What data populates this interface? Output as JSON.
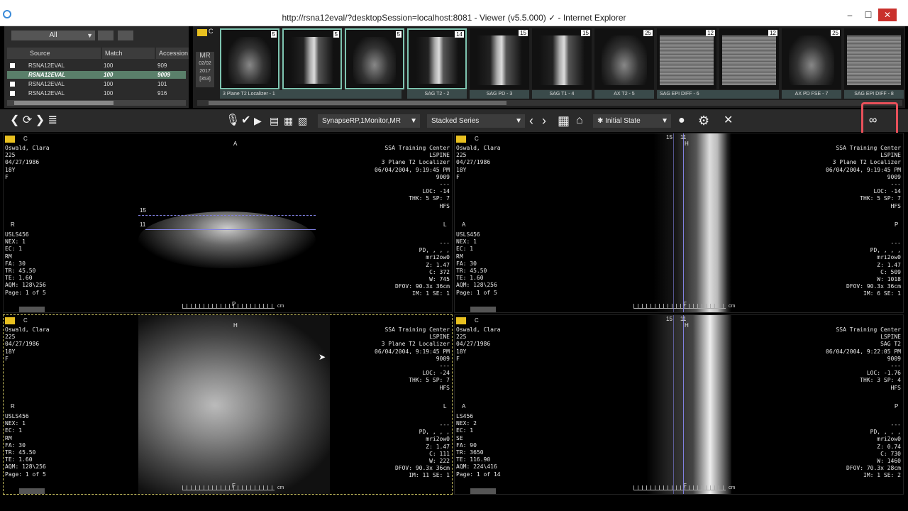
{
  "window": {
    "title": "http://rsna12eval/?desktopSession=localhost:8081 - Viewer (v5.5.000) ✓ - Internet Explorer",
    "min": "–",
    "max": "☐",
    "close": "✕"
  },
  "worklist": {
    "filter": "All",
    "columns": [
      "Source",
      "Match",
      "Accession"
    ],
    "rows": [
      {
        "source": "RSNA12EVAL",
        "match": "100",
        "accession": "909"
      },
      {
        "source": "RSNA12EVAL",
        "match": "100",
        "accession": "9009"
      },
      {
        "source": "RSNA12EVAL",
        "match": "100",
        "accession": "101"
      },
      {
        "source": "RSNA12EVAL",
        "match": "100",
        "accession": "916"
      }
    ]
  },
  "study_tile": {
    "modality": "MR",
    "date_md": "02/02",
    "year": "2017",
    "count": "[353]"
  },
  "thumbnails": [
    {
      "count": "5",
      "label": "3 Plane T2 Localizer - 1"
    },
    {
      "count": "5",
      "label": ""
    },
    {
      "count": "5",
      "label": ""
    },
    {
      "count": "14",
      "label": "SAG T2 - 2"
    },
    {
      "count": "15",
      "label": "SAG PD - 3"
    },
    {
      "count": "15",
      "label": "SAG T1 - 4"
    },
    {
      "count": "25",
      "label": "AX T2 - 5"
    },
    {
      "count": "12",
      "label": "SAG EPI DIFF - 6"
    },
    {
      "count": "12",
      "label": ""
    },
    {
      "count": "25",
      "label": "AX PD FSE - 7"
    },
    {
      "count": "",
      "label": "SAG EPI DIFF - 8"
    }
  ],
  "toolbar": {
    "nav": "❮ ⟳ ❯ ≣",
    "protocol": "SynapseRP,1Monitor,MR",
    "layout": "Stacked Series",
    "state": "✱ Initial State",
    "close": "✕"
  },
  "viewports": [
    {
      "left": "Oswald, Clara\n225\n04/27/1986\n18Y\nF",
      "right": "SSA Training Center\nLSPINE\n3 Plane T2 Localizer\n06/04/2004, 9:19:45 PM\n9009\n---\nLOC: -14\nTHK: 5 SP: 7\nHFS",
      "bl": "USLS456\nNEX: 1\nEC: 1\nRM\nFA: 30\nTR: 45.50\nTE: 1.60\nAQM: 128\\256\nPage: 1 of 5",
      "br": "---\nPD, , , ,\nmri2ow0\nZ: 1.47\nC: 372\nW: 745\nDFOV: 90.3x 36cm\nIM: 1 SE: 1",
      "top": "A",
      "lft": "R",
      "rgt": "L",
      "bot": "P",
      "n1": "15",
      "n2": "11"
    },
    {
      "left": "Oswald, Clara\n225\n04/27/1986\n18Y\nF",
      "right": "SSA Training Center\nLSPINE\n3 Plane T2 Localizer\n06/04/2004, 9:19:45 PM\n9009\n---\nLOC: -14\nTHK: 5 SP: 7\nHFS",
      "bl": "USLS456\nNEX: 1\nEC: 1\nRM\nFA: 30\nTR: 45.50\nTE: 1.60\nAQM: 128\\256\nPage: 1 of 5",
      "br": "---\nPD, , , ,\nmri2ow0\nZ: 1.47\nC: 509\nW: 1018\nDFOV: 90.3x 36cm\nIM: 6 SE: 1",
      "top": "H",
      "lft": "A",
      "rgt": "P",
      "bot": "F",
      "n1": "15",
      "n2": "11"
    },
    {
      "left": "Oswald, Clara\n225\n04/27/1986\n18Y\nF",
      "right": "SSA Training Center\nLSPINE\n3 Plane T2 Localizer\n06/04/2004, 9:19:45 PM\n9009\n---\nLOC: -24\nTHK: 5 SP: 7\nHFS",
      "bl": "USLS456\nNEX: 1\nEC: 1\nRM\nFA: 30\nTR: 45.50\nTE: 1.60\nAQM: 128\\256\nPage: 1 of 5",
      "br": "---\nPD, , , ,\nmri2ow0\nZ: 1.47\nC: 111\nW: 222\nDFOV: 90.3x 36cm\nIM: 11 SE: 1",
      "top": "H",
      "lft": "R",
      "rgt": "L",
      "bot": "F",
      "n1": "",
      "n2": ""
    },
    {
      "left": "Oswald, Clara\n225\n04/27/1986\n18Y\nF",
      "right": "SSA Training Center\nLSPINE\nSAG T2\n06/04/2004, 9:22:05 PM\n9009\n---\nLOC: -1.76\nTHK: 3 SP: 4\nHFS",
      "bl": "LS456\nNEX: 2\nEC: 1\nSE\nFA: 90\nTR: 3650\nTE: 116.90\nAQM: 224\\416\nPage: 1 of 14",
      "br": "---\nPD, , , ,\nmri2ow0\nZ: 0.74\nC: 730\nW: 1460\nDFOV: 70.3x 28cm\nIM: 1 SE: 2",
      "top": "H",
      "lft": "A",
      "rgt": "P",
      "bot": "F",
      "n1": "15",
      "n2": "11"
    }
  ],
  "labels": {
    "c": "C",
    "cm": "cm"
  }
}
